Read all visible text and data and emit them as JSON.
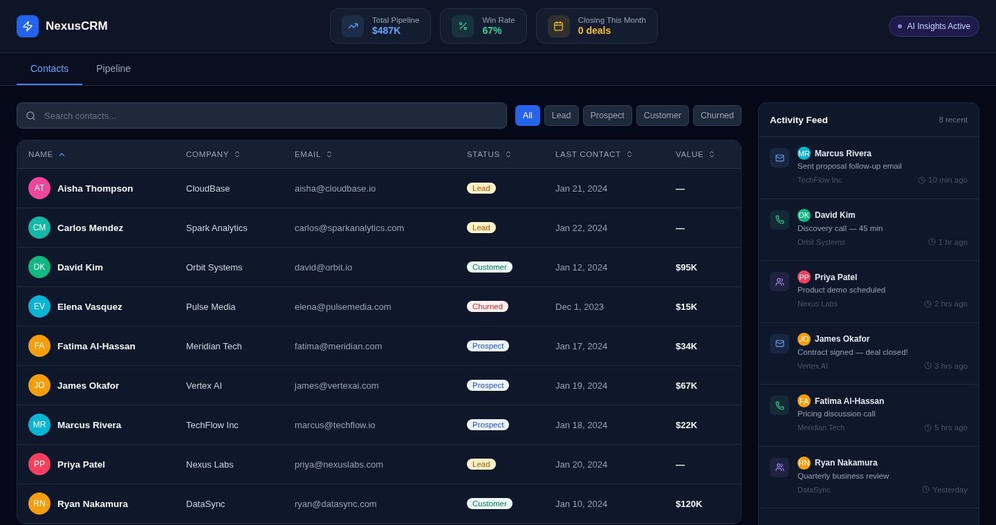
{
  "brand": {
    "name": "NexusCRM"
  },
  "stats": [
    {
      "kind": "trend",
      "label": "Total Pipeline",
      "value": "$487K",
      "color": "#60a5fa"
    },
    {
      "kind": "percent",
      "label": "Win Rate",
      "value": "67%",
      "color": "#34d399"
    },
    {
      "kind": "calendar",
      "label": "Closing This Month",
      "value": "0 deals",
      "color": "#fbbf24"
    }
  ],
  "ai_badge": {
    "label": "AI Insights Active"
  },
  "tabs": [
    {
      "label": "Contacts",
      "selected": true
    },
    {
      "label": "Pipeline",
      "selected": false
    }
  ],
  "search": {
    "placeholder": "Search contacts..."
  },
  "filters": [
    {
      "label": "All",
      "selected": true
    },
    {
      "label": "Lead",
      "selected": false
    },
    {
      "label": "Prospect",
      "selected": false
    },
    {
      "label": "Customer",
      "selected": false
    },
    {
      "label": "Churned",
      "selected": false
    }
  ],
  "table": {
    "columns": [
      {
        "label": "NAME",
        "sorted": true
      },
      {
        "label": "COMPANY",
        "sorted": false
      },
      {
        "label": "EMAIL",
        "sorted": false
      },
      {
        "label": "STATUS",
        "sorted": false
      },
      {
        "label": "LAST CONTACT",
        "sorted": false
      },
      {
        "label": "VALUE",
        "sorted": false
      }
    ],
    "rows": [
      {
        "initials": "AT",
        "color": "#ec4899",
        "name": "Aisha Thompson",
        "company": "CloudBase",
        "email": "aisha@cloudbase.io",
        "status": "Lead",
        "kind": "lead",
        "last_contact": "Jan 21, 2024",
        "value": "—"
      },
      {
        "initials": "CM",
        "color": "#14b8a6",
        "name": "Carlos Mendez",
        "company": "Spark Analytics",
        "email": "carlos@sparkanalytics.com",
        "status": "Lead",
        "kind": "lead",
        "last_contact": "Jan 22, 2024",
        "value": "—"
      },
      {
        "initials": "DK",
        "color": "#10b981",
        "name": "David Kim",
        "company": "Orbit Systems",
        "email": "david@orbit.io",
        "status": "Customer",
        "kind": "customer",
        "last_contact": "Jan 12, 2024",
        "value": "$95K"
      },
      {
        "initials": "EV",
        "color": "#06b6d4",
        "name": "Elena Vasquez",
        "company": "Pulse Media",
        "email": "elena@pulsemedia.com",
        "status": "Churned",
        "kind": "churned",
        "last_contact": "Dec 1, 2023",
        "value": "$15K"
      },
      {
        "initials": "FA",
        "color": "#f59e0b",
        "name": "Fatima Al-Hassan",
        "company": "Meridian Tech",
        "email": "fatima@meridian.com",
        "status": "Prospect",
        "kind": "prospect",
        "last_contact": "Jan 17, 2024",
        "value": "$34K"
      },
      {
        "initials": "JO",
        "color": "#f59e0b",
        "name": "James Okafor",
        "company": "Vertex AI",
        "email": "james@vertexai.com",
        "status": "Prospect",
        "kind": "prospect",
        "last_contact": "Jan 19, 2024",
        "value": "$67K"
      },
      {
        "initials": "MR",
        "color": "#06b6d4",
        "name": "Marcus Rivera",
        "company": "TechFlow Inc",
        "email": "marcus@techflow.io",
        "status": "Prospect",
        "kind": "prospect",
        "last_contact": "Jan 18, 2024",
        "value": "$22K"
      },
      {
        "initials": "PP",
        "color": "#f43f5e",
        "name": "Priya Patel",
        "company": "Nexus Labs",
        "email": "priya@nexuslabs.com",
        "status": "Lead",
        "kind": "lead",
        "last_contact": "Jan 20, 2024",
        "value": "—"
      },
      {
        "initials": "RN",
        "color": "#f59e0b",
        "name": "Ryan Nakamura",
        "company": "DataSync",
        "email": "ryan@datasync.com",
        "status": "Customer",
        "kind": "customer",
        "last_contact": "Jan 10, 2024",
        "value": "$120K"
      }
    ]
  },
  "activity_feed": {
    "title": "Activity Feed",
    "count": "8 recent",
    "items": [
      {
        "kind": "email",
        "initials": "MR",
        "color": "#06b6d4",
        "name": "Marcus Rivera",
        "text": "Sent proposal follow-up email",
        "company": "TechFlow Inc",
        "time": "10 min ago"
      },
      {
        "kind": "call",
        "initials": "DK",
        "color": "#10b981",
        "name": "David Kim",
        "text": "Discovery call — 45 min",
        "company": "Orbit Systems",
        "time": "1 hr ago"
      },
      {
        "kind": "meeting",
        "initials": "PP",
        "color": "#f43f5e",
        "name": "Priya Patel",
        "text": "Product demo scheduled",
        "company": "Nexus Labs",
        "time": "2 hrs ago"
      },
      {
        "kind": "email",
        "initials": "JO",
        "color": "#f59e0b",
        "name": "James Okafor",
        "text": "Contract signed — deal closed!",
        "company": "Vertex AI",
        "time": "3 hrs ago"
      },
      {
        "kind": "call",
        "initials": "FA",
        "color": "#f59e0b",
        "name": "Fatima Al-Hassan",
        "text": "Pricing discussion call",
        "company": "Meridian Tech",
        "time": "5 hrs ago"
      },
      {
        "kind": "meeting",
        "initials": "RN",
        "color": "#f59e0b",
        "name": "Ryan Nakamura",
        "text": "Quarterly business review",
        "company": "DataSync",
        "time": "Yesterday"
      }
    ]
  }
}
